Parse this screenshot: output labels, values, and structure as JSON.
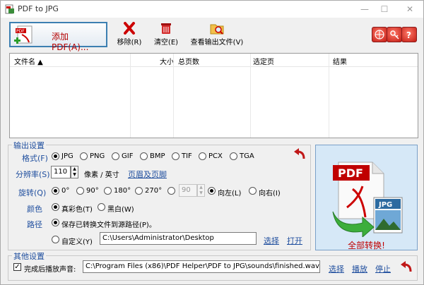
{
  "window": {
    "title": "PDF to JPG",
    "minimize_icon": "minimize-icon",
    "maximize_icon": "maximize-icon",
    "close_icon": "close-icon"
  },
  "toolbar": {
    "add_pdf_label": "添加 PDF(A)...",
    "remove_label": "移除(R)",
    "clear_label": "清空(E)",
    "view_output_label": "查看输出文件(V)",
    "right_buttons": [
      "globe-icon",
      "key-icon",
      "help-icon"
    ]
  },
  "file_table": {
    "columns": [
      "文件名 ▲",
      "大小",
      "总页数",
      "选定页",
      "结果"
    ],
    "rows": []
  },
  "output_settings": {
    "legend": "输出设置",
    "format": {
      "label": "格式(F)",
      "options": [
        "JPG",
        "PNG",
        "GIF",
        "BMP",
        "TIF",
        "PCX",
        "TGA"
      ],
      "selected": "JPG"
    },
    "resolution": {
      "label": "分辨率(S)",
      "value": "110",
      "unit": "像素 / 英寸",
      "link": "页眉及页脚"
    },
    "rotate": {
      "label": "旋转(Q)",
      "options": [
        "0°",
        "90°",
        "180°",
        "270°"
      ],
      "selected": "0°",
      "custom_value": "90",
      "dir_options": [
        "向左(L)",
        "向右(I)"
      ],
      "dir_selected": "向左(L)"
    },
    "color": {
      "label": "颜色",
      "options": [
        "真彩色(T)",
        "黑白(W)"
      ],
      "selected": "真彩色(T)"
    },
    "path": {
      "label": "路径",
      "save_to_source": "保存已转换文件到源路径(P)。",
      "custom_label": "自定义(Y)",
      "custom_value": "C:\\Users\\Administrator\\Desktop",
      "choose_link": "选择",
      "open_link": "打开"
    }
  },
  "convert": {
    "label": "全部转换!",
    "icon": "pdf-to-jpg-icon"
  },
  "other_settings": {
    "legend": "其他设置",
    "sound_label": "完成后播放声音:",
    "sound_checked": true,
    "sound_path": "C:\\Program Files (x86)\\PDF Helper\\PDF to JPG\\sounds\\finished.wav",
    "choose_link": "选择",
    "play_link": "播放",
    "stop_link": "停止"
  },
  "colors": {
    "accent": "#1f4e9e",
    "brand_red": "#c00000",
    "convert_bg": "#d6e8f7"
  }
}
